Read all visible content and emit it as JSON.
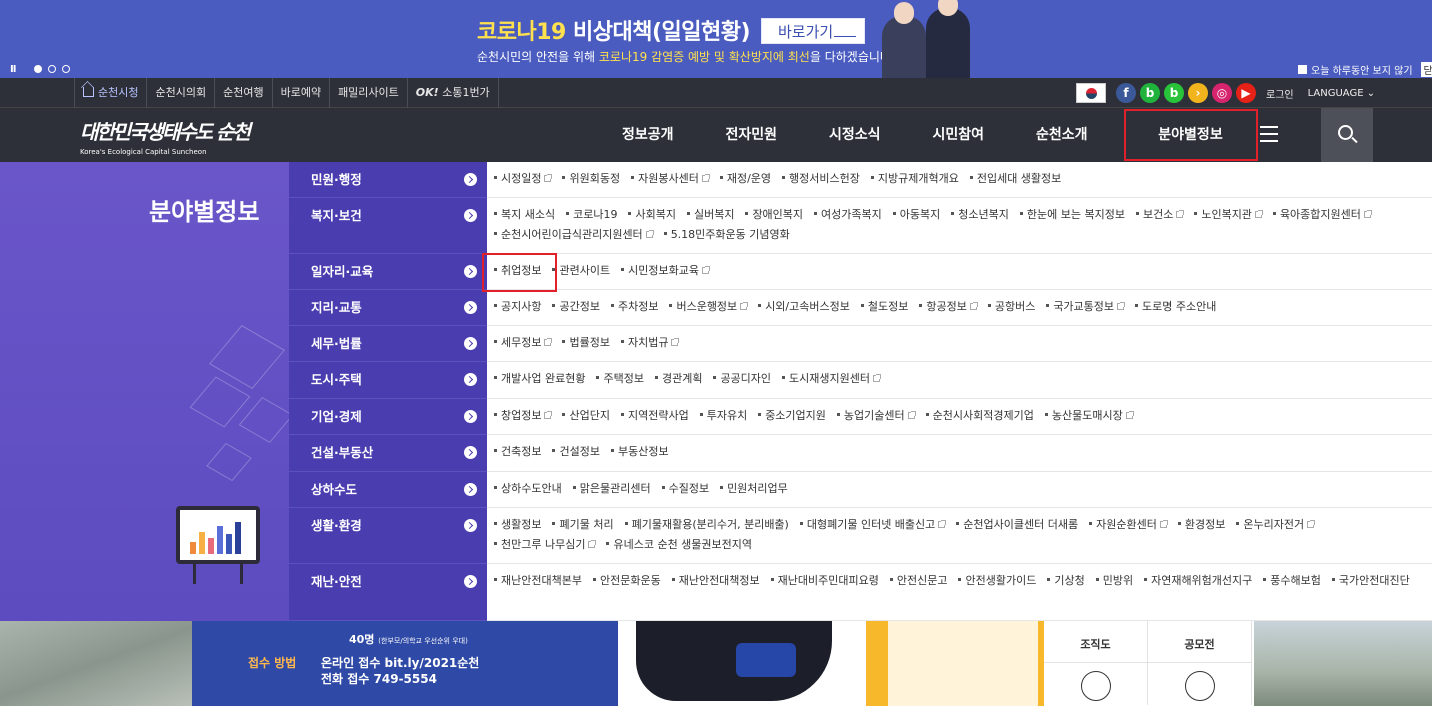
{
  "banner": {
    "title_yellow": "코로나19 ",
    "title_white": "비상대책(일일현황)",
    "go_button": "바로가기",
    "sub_pre": "순천시민의 안전을 위해 ",
    "sub_highlight": "코로나19 감염증 예방 및 확산방지에 최선",
    "sub_post": "을 다하겠습니다.",
    "pause": "II",
    "no_show_label": "오늘 하루동안 보지 않기",
    "close_label": "닫기"
  },
  "util": {
    "items": [
      "순천시청",
      "순천시의회",
      "순천여행",
      "바로예약",
      "패밀리사이트",
      "소통1번가"
    ],
    "ok_prefix": "OK!",
    "login": "로그인",
    "language": "LANGUAGE",
    "sns": [
      {
        "name": "facebook-icon",
        "glyph": "f",
        "color": "#3b5998"
      },
      {
        "name": "blog-icon",
        "glyph": "b",
        "color": "#1fb33c"
      },
      {
        "name": "band-icon",
        "glyph": "b",
        "color": "#29c33a"
      },
      {
        "name": "kakao-story-icon",
        "glyph": "›",
        "color": "#f2b41d"
      },
      {
        "name": "instagram-icon",
        "glyph": "◎",
        "color": "#d6246e"
      },
      {
        "name": "youtube-icon",
        "glyph": "▶",
        "color": "#e62117"
      }
    ]
  },
  "logo": {
    "korean": "대한민국생태수도 순천",
    "english": "Korea's Ecological Capital Suncheon"
  },
  "nav": {
    "items": [
      "정보공개",
      "전자민원",
      "시정소식",
      "시민참여",
      "순천소개",
      "분야별정보"
    ]
  },
  "mega": {
    "title": "분야별정보",
    "categories": [
      {
        "label": "민원·행정",
        "links": [
          {
            "t": "시정일정",
            "e": true
          },
          {
            "t": "위원회동정",
            "e": false
          },
          {
            "t": "자원봉사센터",
            "e": true
          },
          {
            "t": "재정/운영",
            "e": false
          },
          {
            "t": "행정서비스헌장",
            "e": false
          },
          {
            "t": "지방규제개혁개요",
            "e": false
          },
          {
            "t": "전입세대 생활정보",
            "e": false
          }
        ]
      },
      {
        "label": "복지·보건",
        "links": [
          {
            "t": "복지 새소식",
            "e": false
          },
          {
            "t": "코로나19",
            "e": false
          },
          {
            "t": "사회복지",
            "e": false
          },
          {
            "t": "실버복지",
            "e": false
          },
          {
            "t": "장애인복지",
            "e": false
          },
          {
            "t": "여성가족복지",
            "e": false
          },
          {
            "t": "아동복지",
            "e": false
          },
          {
            "t": "청소년복지",
            "e": false
          },
          {
            "t": "한눈에 보는 복지정보",
            "e": false
          },
          {
            "t": "보건소",
            "e": true
          },
          {
            "t": "노인복지관",
            "e": true
          },
          {
            "t": "육아종합지원센터",
            "e": true
          },
          {
            "t": "순천시어린이급식관리지원센터",
            "e": true
          },
          {
            "t": "5.18민주화운동 기념영화",
            "e": false
          }
        ]
      },
      {
        "label": "일자리·교육",
        "links": [
          {
            "t": "취업정보",
            "e": false
          },
          {
            "t": "관련사이트",
            "e": false
          },
          {
            "t": "시민정보화교육",
            "e": true
          }
        ]
      },
      {
        "label": "지리·교통",
        "links": [
          {
            "t": "공지사항",
            "e": false
          },
          {
            "t": "공간정보",
            "e": false
          },
          {
            "t": "주차정보",
            "e": false
          },
          {
            "t": "버스운행정보",
            "e": true
          },
          {
            "t": "시외/고속버스정보",
            "e": false
          },
          {
            "t": "철도정보",
            "e": false
          },
          {
            "t": "항공정보",
            "e": true
          },
          {
            "t": "공항버스",
            "e": false
          },
          {
            "t": "국가교통정보",
            "e": true
          },
          {
            "t": "도로명 주소안내",
            "e": false
          }
        ]
      },
      {
        "label": "세무·법률",
        "links": [
          {
            "t": "세무정보",
            "e": true
          },
          {
            "t": "법률정보",
            "e": false
          },
          {
            "t": "자치법규",
            "e": true
          }
        ]
      },
      {
        "label": "도시·주택",
        "links": [
          {
            "t": "개발사업 완료현황",
            "e": false
          },
          {
            "t": "주택정보",
            "e": false
          },
          {
            "t": "경관계획",
            "e": false
          },
          {
            "t": "공공디자인",
            "e": false
          },
          {
            "t": "도시재생지원센터",
            "e": true
          }
        ]
      },
      {
        "label": "기업·경제",
        "links": [
          {
            "t": "창업정보",
            "e": true
          },
          {
            "t": "산업단지",
            "e": false
          },
          {
            "t": "지역전략사업",
            "e": false
          },
          {
            "t": "투자유치",
            "e": false
          },
          {
            "t": "중소기업지원",
            "e": false
          },
          {
            "t": "농업기술센터",
            "e": true
          },
          {
            "t": "순천시사회적경제기업",
            "e": false
          },
          {
            "t": "농산물도매시장",
            "e": true
          }
        ]
      },
      {
        "label": "건설·부동산",
        "links": [
          {
            "t": "건축정보",
            "e": false
          },
          {
            "t": "건설정보",
            "e": false
          },
          {
            "t": "부동산정보",
            "e": false
          }
        ]
      },
      {
        "label": "상하수도",
        "links": [
          {
            "t": "상하수도안내",
            "e": false
          },
          {
            "t": "맑은물관리센터",
            "e": false
          },
          {
            "t": "수질정보",
            "e": false
          },
          {
            "t": "민원처리업무",
            "e": false
          }
        ]
      },
      {
        "label": "생활·환경",
        "links": [
          {
            "t": "생활정보",
            "e": false
          },
          {
            "t": "폐기물 처리",
            "e": false
          },
          {
            "t": "폐기물재활용(분리수거, 분리배출)",
            "e": false
          },
          {
            "t": "대형폐기물 인터넷 배출신고",
            "e": true
          },
          {
            "t": "순천업사이클센터 더새롬",
            "e": false
          },
          {
            "t": "자원순환센터",
            "e": true
          },
          {
            "t": "환경정보",
            "e": false
          },
          {
            "t": "온누리자전거",
            "e": true
          },
          {
            "t": "천만그루 나무심기",
            "e": true
          },
          {
            "t": "유네스코 순천 생물권보전지역",
            "e": false
          }
        ]
      },
      {
        "label": "재난·안전",
        "links": [
          {
            "t": "재난안전대책본부",
            "e": false
          },
          {
            "t": "안전문화운동",
            "e": false
          },
          {
            "t": "재난안전대책정보",
            "e": false
          },
          {
            "t": "재난대비주민대피요령",
            "e": false
          },
          {
            "t": "안전신문고",
            "e": false
          },
          {
            "t": "안전생활가이드",
            "e": false
          },
          {
            "t": "기상청",
            "e": false
          },
          {
            "t": "민방위",
            "e": false
          },
          {
            "t": "자연재해위험개선지구",
            "e": false
          },
          {
            "t": "풍수해보험",
            "e": false
          },
          {
            "t": "국가안전대진단",
            "e": false
          }
        ]
      }
    ]
  },
  "bottom": {
    "count": "40명",
    "count_note": "(한부모/의학교 우선순위 우대)",
    "apply_label": "접수 방법",
    "apply_online": "온라인 접수 bit.ly/2021순천",
    "apply_phone": "전화 접수 749-5554",
    "grid": [
      "조직도",
      "공모전"
    ]
  }
}
